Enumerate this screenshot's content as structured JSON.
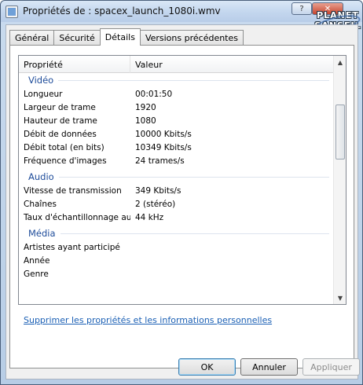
{
  "window": {
    "title": "Propriétés de : spacex_launch_1080i.wmv",
    "help_label": "?",
    "close_label": "✕"
  },
  "logo": {
    "line1": "PLANET",
    "line2": "SANSFIL"
  },
  "tabs": [
    {
      "label": "Général",
      "active": false
    },
    {
      "label": "Sécurité",
      "active": false
    },
    {
      "label": "Détails",
      "active": true
    },
    {
      "label": "Versions précédentes",
      "active": false
    }
  ],
  "details": {
    "columns": {
      "property": "Propriété",
      "value": "Valeur"
    },
    "groups": {
      "video": "Vidéo",
      "audio": "Audio",
      "media": "Média"
    },
    "video_rows": [
      {
        "k": "Longueur",
        "v": "00:01:50"
      },
      {
        "k": "Largeur de trame",
        "v": "1920"
      },
      {
        "k": "Hauteur de trame",
        "v": "1080"
      },
      {
        "k": "Débit de données",
        "v": "10000 Kbits/s"
      },
      {
        "k": "Débit total (en bits)",
        "v": "10349 Kbits/s"
      },
      {
        "k": "Fréquence d'images",
        "v": "24 trames/s"
      }
    ],
    "audio_rows": [
      {
        "k": "Vitesse de transmission",
        "v": "349 Kbits/s"
      },
      {
        "k": "Chaînes",
        "v": "2 (stéréo)"
      },
      {
        "k": "Taux d'échantillonnage audio",
        "v": "44 kHz"
      }
    ],
    "media_rows": [
      {
        "k": "Artistes ayant participé",
        "v": ""
      },
      {
        "k": "Année",
        "v": ""
      },
      {
        "k": "Genre",
        "v": ""
      }
    ]
  },
  "remove_link": "Supprimer les propriétés et les informations personnelles",
  "buttons": {
    "ok": "OK",
    "cancel": "Annuler",
    "apply": "Appliquer"
  },
  "icons": {
    "scroll_up": "▲",
    "scroll_down": "▼"
  }
}
